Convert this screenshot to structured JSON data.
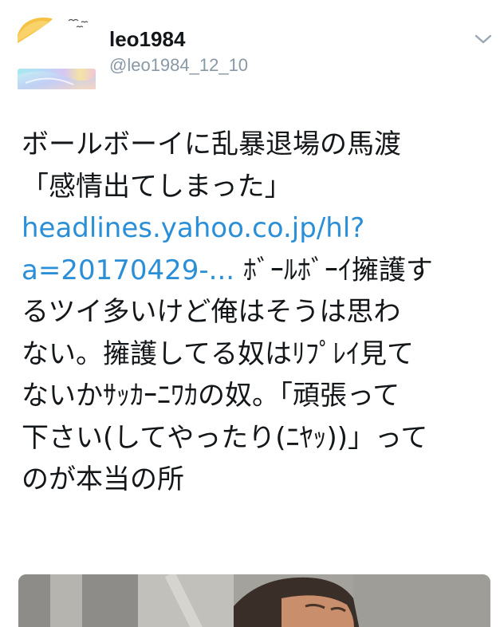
{
  "user": {
    "display_name": "leo1984",
    "handle": "@leo1984_12_10",
    "avatar_icon": "avatar-image"
  },
  "menu": {
    "icon": "chevron-down-icon"
  },
  "tweet": {
    "line1": "ボールボーイに乱暴退場の馬渡",
    "line2": "「感情出てしまった」",
    "link_line1": "headlines.yahoo.co.jp/hl?",
    "link_line2": "a=20170429-...",
    "line4_rest": " ﾎﾞｰﾙﾎﾞｰｲ擁護す",
    "line5": "るツイ多いけど俺はそうは思わ",
    "line6": "ない。擁護してる奴はﾘﾌﾟﾚｲ見て",
    "line7": "ないかｻｯｶｰﾆﾜｶの奴。「頑張って",
    "line8": "下さい(してやったり(ﾆﾔｯ))」って",
    "line9": "のが本当の所"
  },
  "media": {
    "kind": "photo"
  },
  "colors": {
    "text": "#14171a",
    "secondary": "#8899a6",
    "link": "#2b8fd8"
  }
}
